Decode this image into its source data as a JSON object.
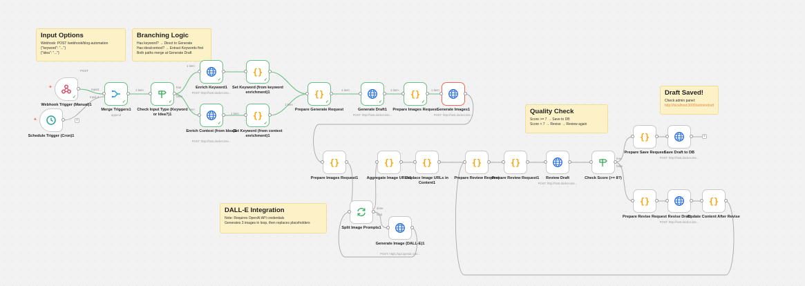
{
  "notes": {
    "input_options": {
      "title": "Input Options",
      "lines": [
        "Webhook: POST /webhook/blog-automation",
        "{\"keyword\": \"...\"}",
        "{\"idea\": \"...\"}"
      ]
    },
    "branching_logic": {
      "title": "Branching Logic",
      "lines": [
        "Has keyword? → Direct to Generate",
        "Has idea/context? → Extract Keywords first",
        "Both paths merge at Generate Draft"
      ]
    },
    "quality_check": {
      "title": "Quality Check",
      "lines": [
        "Score >= 7 → Save to DB",
        "Score < 7 → Revise → Review again"
      ]
    },
    "draft_saved": {
      "title": "Draft Saved!",
      "lines": [
        "Check admin panel:",
        "http://localhost:3000/admin/drafts"
      ]
    },
    "dalle": {
      "title": "DALL-E Integration",
      "lines": [
        "Note: Requires OpenAI API credentials",
        "Generates 3 images in loop, then replaces placeholders"
      ]
    }
  },
  "nodes": {
    "webhook": {
      "label": "Webhook Trigger (Manual)1",
      "icon": "webhook-icon"
    },
    "schedule": {
      "label": "Schedule Trigger (Cron)1",
      "icon": "clock-icon"
    },
    "merge": {
      "label": "Merge Triggers1",
      "sub": "append",
      "icon": "merge-icon"
    },
    "check_input": {
      "label": "Check Input Type (Keyword or Idea?)1",
      "icon": "if-icon"
    },
    "enrich_keyword": {
      "label": "Enrich Keyword1",
      "sub": "POST: http://host.docker.inte...",
      "icon": "globe-icon"
    },
    "set_kw_keyword": {
      "label": "Set Keyword (from keyword enrichment)1",
      "icon": "code-icon"
    },
    "enrich_context": {
      "label": "Enrich Context (from Idea)1",
      "sub": "POST: http://host.docker.inte...",
      "icon": "globe-icon"
    },
    "set_kw_context": {
      "label": "Set Keyword (from context enrichment)1",
      "icon": "code-icon"
    },
    "prepare_generate": {
      "label": "Prepare Generate Request",
      "icon": "code-icon"
    },
    "generate_draft": {
      "label": "Generate Draft1",
      "sub": "POST: http://host.docker.inte...",
      "icon": "globe-icon"
    },
    "prepare_images_top": {
      "label": "Prepare Images Request",
      "icon": "code-icon"
    },
    "generate_images": {
      "label": "Generate Images1",
      "sub": "POST: http://host.docker.inte...",
      "icon": "globe-icon"
    },
    "prepare_images": {
      "label": "Prepare Images Request1",
      "icon": "code-icon"
    },
    "aggregate": {
      "label": "Aggregate Image URLs1",
      "icon": "code-icon"
    },
    "replace": {
      "label": "Replace Image URLs in Content1",
      "icon": "code-icon"
    },
    "prepare_review": {
      "label": "Prepare Review Request",
      "icon": "code-icon"
    },
    "prepare_review1": {
      "label": "Prepare Review Request1",
      "icon": "code-icon"
    },
    "review": {
      "label": "Review Draft",
      "sub": "POST: http://host.docker.inte...",
      "icon": "globe-icon"
    },
    "check_score": {
      "label": "Check Score (>= 8?)",
      "icon": "if-icon"
    },
    "prepare_save": {
      "label": "Prepare Save Request",
      "icon": "code-icon"
    },
    "save": {
      "label": "Save Draft to DB",
      "sub": "POST: http://host.docker.inte...",
      "icon": "globe-icon"
    },
    "prepare_revise": {
      "label": "Prepare Revise Request",
      "icon": "code-icon"
    },
    "revise": {
      "label": "Revise Draft",
      "sub": "POST: http://host.docker.inte...",
      "icon": "globe-icon"
    },
    "update_content": {
      "label": "Update Content After Revise",
      "icon": "code-icon"
    },
    "split": {
      "label": "Split Image Prompts1",
      "icon": "loop-icon"
    },
    "generate_dalle": {
      "label": "Generate Image (DALL-E)1",
      "sub": "POST: https://api.openai.com...",
      "icon": "globe-icon"
    }
  },
  "edge_labels": {
    "webhook_post": "POST",
    "merge_in1": "Input1",
    "merge_in2": "Input 2",
    "item1": "1 item",
    "true": "true",
    "false": "false",
    "done": "done",
    "loop": "loop"
  },
  "colors": {
    "success": "#3bab5c",
    "code": "#f3a712",
    "http": "#2a6fdb",
    "webhook": "#d84c65",
    "error": "#ea6a54",
    "note": "#fdf1c8"
  }
}
